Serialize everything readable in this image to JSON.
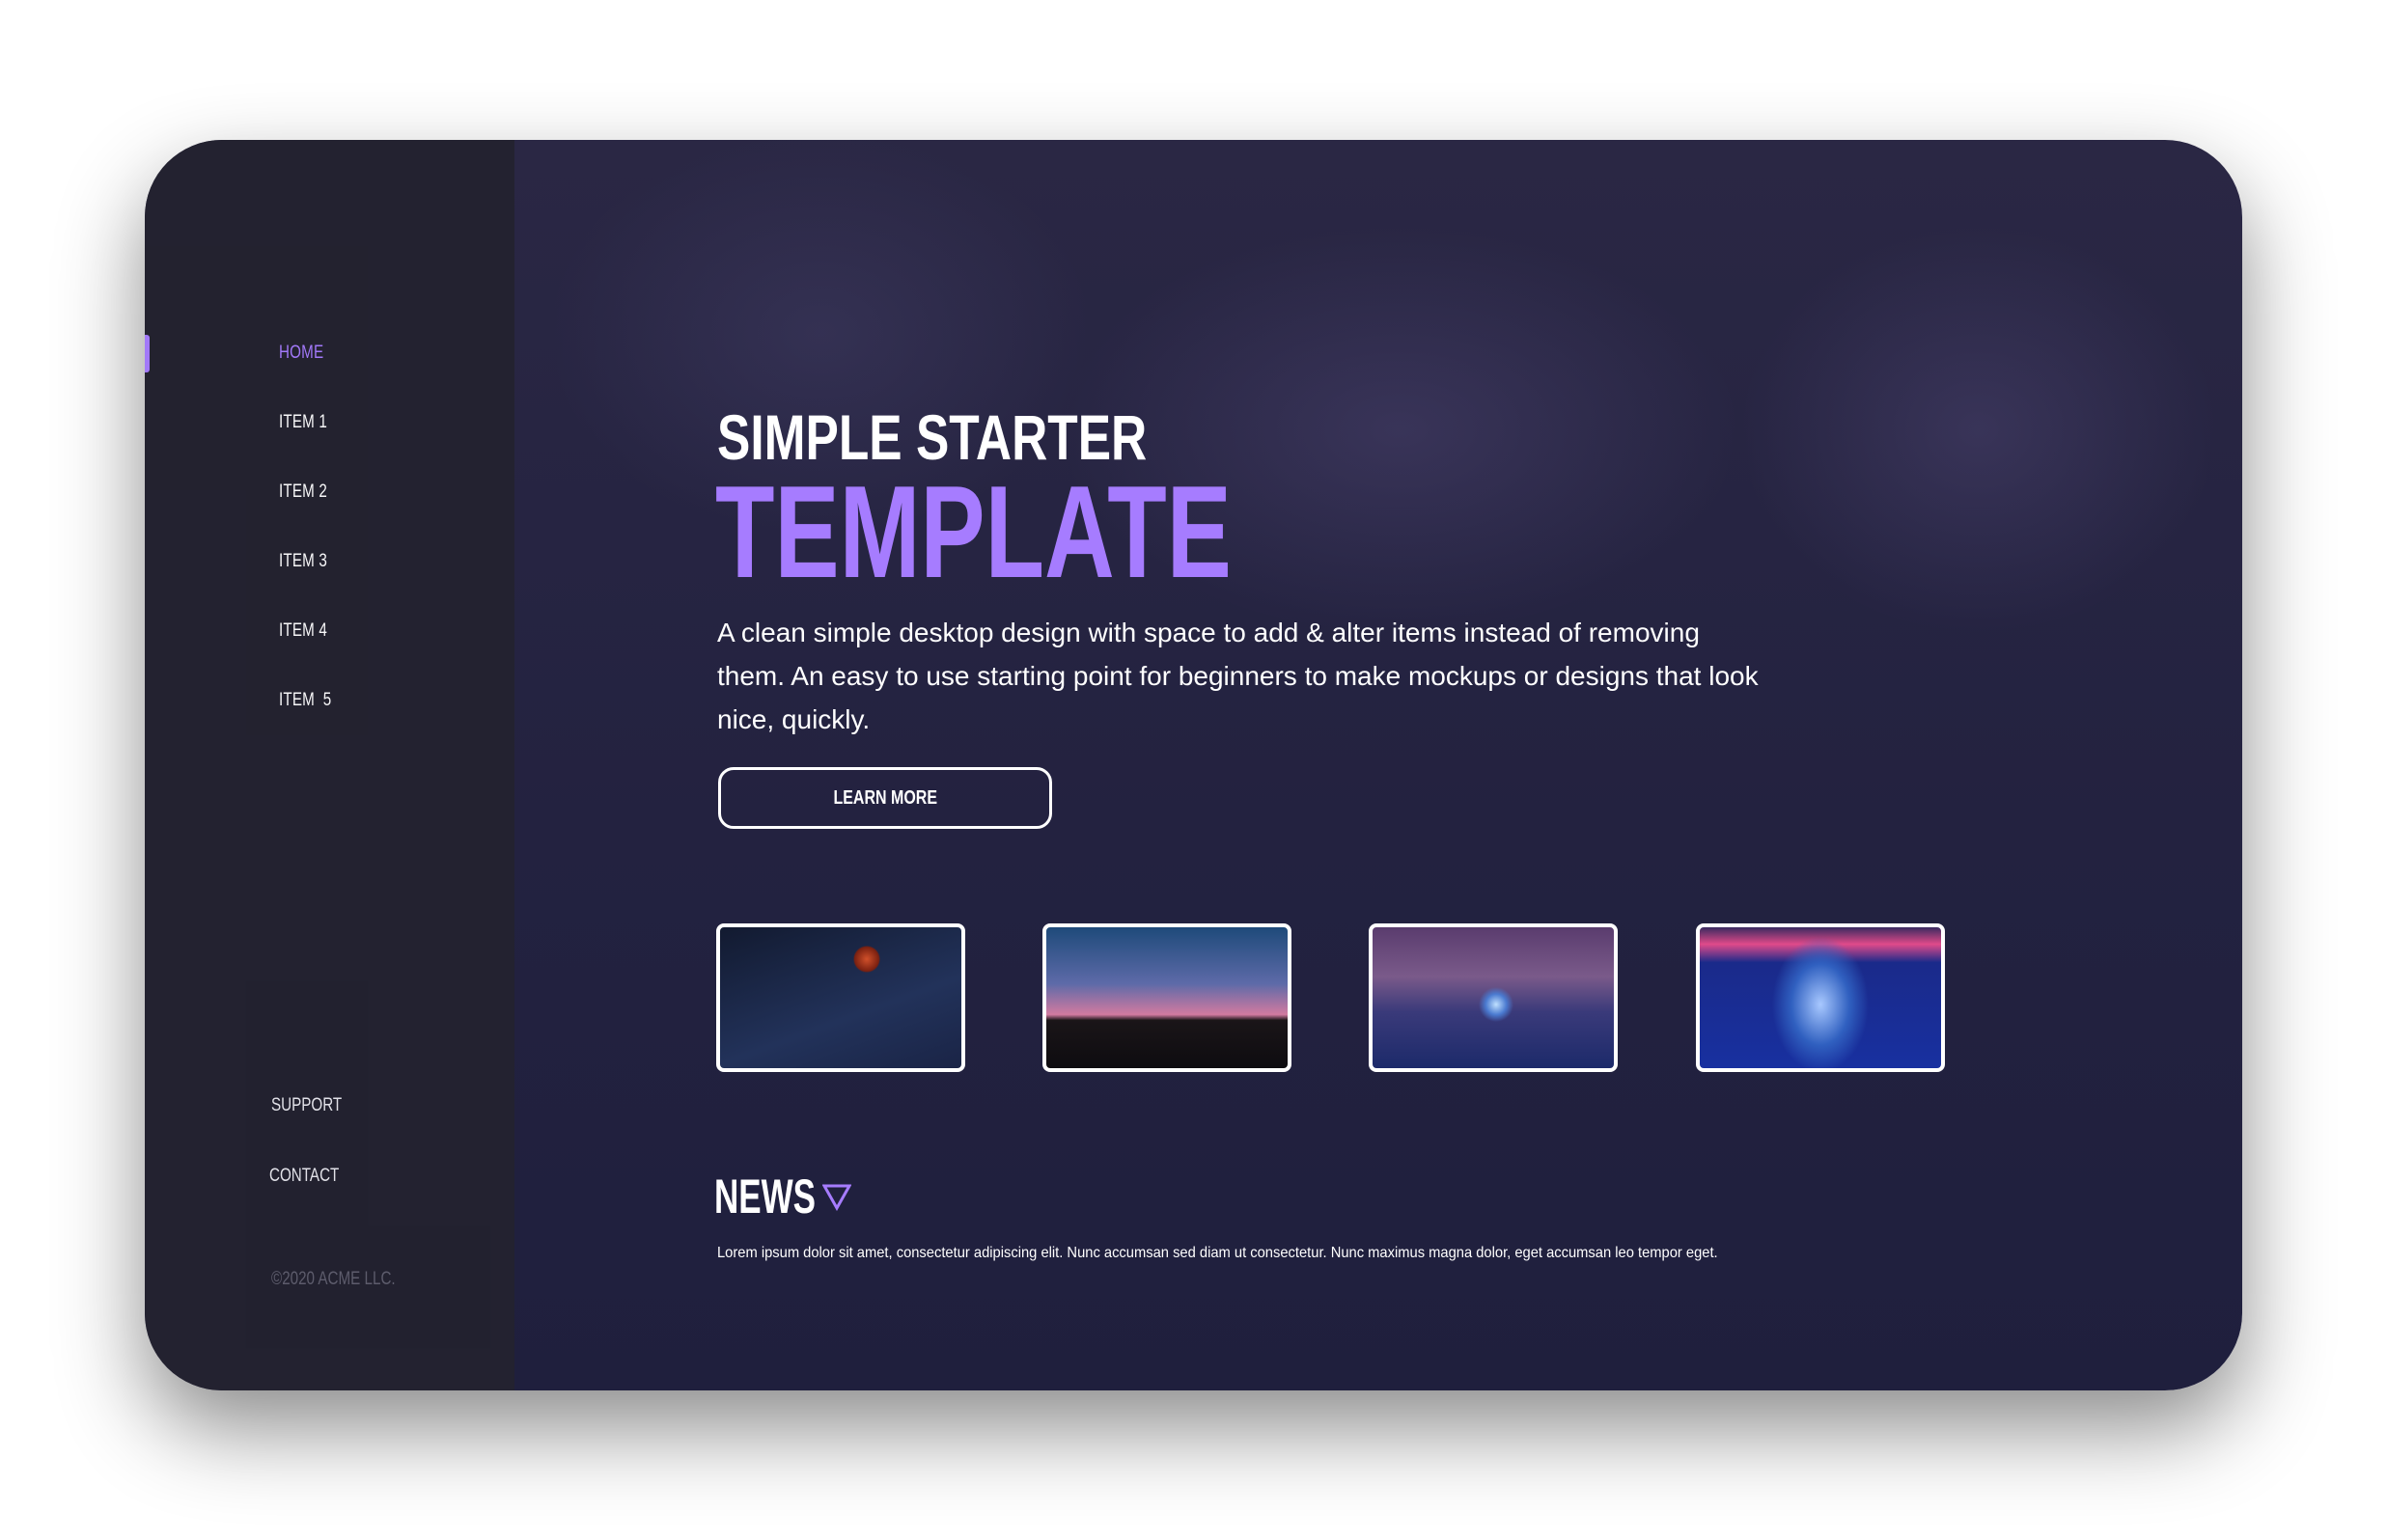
{
  "sidebar": {
    "items": [
      {
        "label": "HOME",
        "active": true
      },
      {
        "label": "ITEM 1"
      },
      {
        "label": "ITEM 2"
      },
      {
        "label": "ITEM 3"
      },
      {
        "label": "ITEM 4"
      },
      {
        "label": "ITEM  5"
      }
    ],
    "support": "SUPPORT",
    "contact": "CONTACT",
    "copyright": "©2020 ACME LLC."
  },
  "hero": {
    "title_line1": "SIMPLE STARTER",
    "title_line2": "TEMPLATE",
    "description": "A clean simple desktop design with space to add & alter items instead of removing them. An easy to use starting point for beginners to make mockups or designs that look nice, quickly.",
    "button": "LEARN MORE"
  },
  "gallery": [
    {
      "name": "red-moon-milky-way"
    },
    {
      "name": "starry-sky-rocks"
    },
    {
      "name": "person-light-orb-night"
    },
    {
      "name": "neon-robot-figure"
    }
  ],
  "news": {
    "title": "NEWS",
    "icon": "triangle-down-icon",
    "text": "Lorem ipsum dolor sit amet, consectetur adipiscing elit. Nunc accumsan sed diam ut consectetur. Nunc maximus magna dolor, eget accumsan leo tempor eget."
  },
  "colors": {
    "accent": "#a67cff",
    "sidebar": "#23222f",
    "main": "#232240"
  }
}
